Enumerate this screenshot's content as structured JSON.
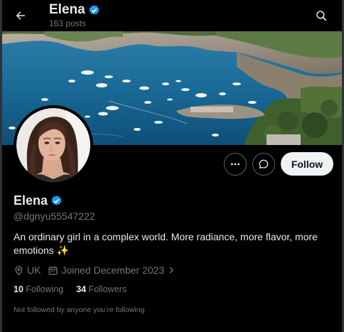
{
  "header": {
    "name": "Elena",
    "posts": "163 posts",
    "icons": {
      "back": "arrow-left-icon",
      "search": "search-icon",
      "verified": "verified-badge-icon"
    }
  },
  "profile": {
    "display_name": "Elena",
    "handle": "@dgnyu55547222",
    "bio": "An ordinary girl in a complex world. More radiance, more flavor, more emotions ✨",
    "location": "UK",
    "joined": "Joined December 2023",
    "following_count": "10",
    "following_label": "Following",
    "followers_count": "34",
    "followers_label": "Followers",
    "not_followed": "Not followed by anyone you’re following"
  },
  "actions": {
    "follow_label": "Follow",
    "icons": {
      "more": "more-icon",
      "message": "message-icon"
    }
  },
  "colors": {
    "background": "#000000",
    "text_primary": "#e7e9ea",
    "text_secondary": "#71767b",
    "verified": "#1d9bf0",
    "follow_button_bg": "#eff3f4",
    "border": "#2f3336"
  }
}
